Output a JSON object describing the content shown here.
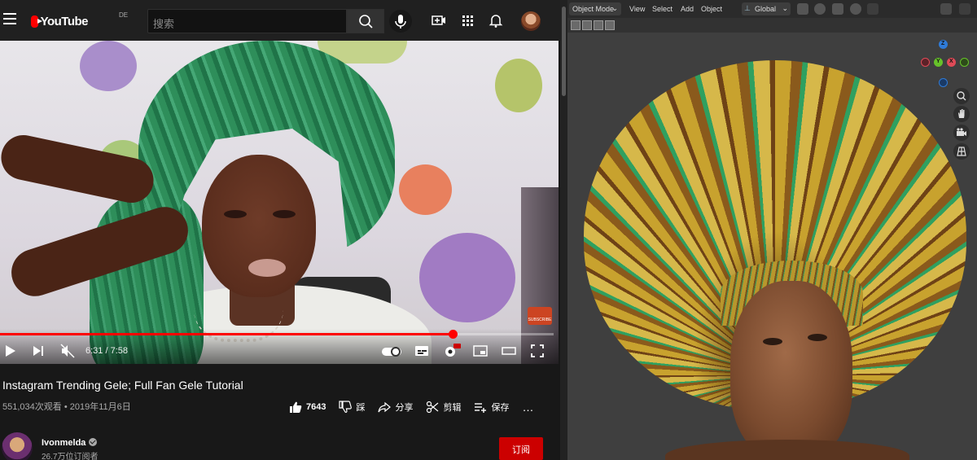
{
  "youtube": {
    "logo_text": "YouTube",
    "region": "DE",
    "search_placeholder": "搜索",
    "video": {
      "time_current": "6:31",
      "time_separator": " / ",
      "time_total": "7:58",
      "progress_fraction": 0.817,
      "subscribe_badge": "SUBSCRIBE"
    },
    "title": "Instagram Trending Gele; Full Fan Gele Tutorial",
    "views": "551,034次观看",
    "date": "2019年11月6日",
    "meta_separator": " • ",
    "actions": {
      "like_count": "7643",
      "dislike_label": "踩",
      "share_label": "分享",
      "clip_label": "剪辑",
      "save_label": "保存",
      "more_label": "…"
    },
    "channel": {
      "name": "Ivonmelda",
      "subscribers": "26.7万位订阅者",
      "subscribe_label": "订阅"
    },
    "colors": {
      "brand_red": "#ff0000",
      "subscribe_red": "#cc0000",
      "background": "#181818"
    }
  },
  "blender": {
    "mode_label": "Object Mode",
    "menu": [
      "View",
      "Select",
      "Add",
      "Object"
    ],
    "transform_orientation": "Global",
    "gizmo": {
      "z_label": "Z",
      "y_label": "Y",
      "x_label": "X"
    },
    "nav_icons": [
      "zoom-icon",
      "pan-hand-icon",
      "camera-icon",
      "grid-icon"
    ]
  }
}
